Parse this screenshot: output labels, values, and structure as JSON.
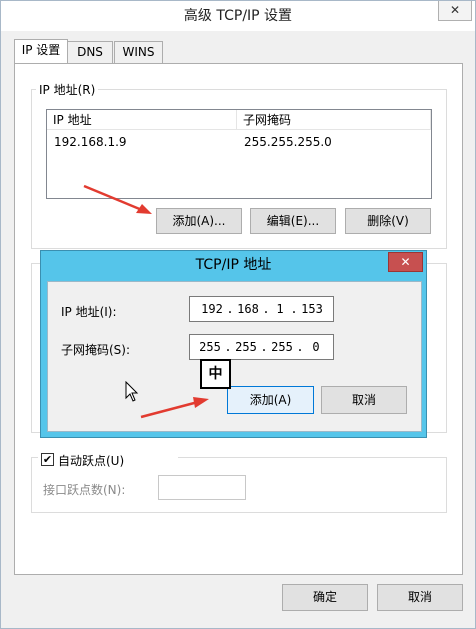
{
  "main_window": {
    "title": "高级 TCP/IP 设置",
    "close_glyph": "✕",
    "tabs": [
      {
        "label": "IP 设置",
        "active": true
      },
      {
        "label": "DNS",
        "active": false
      },
      {
        "label": "WINS",
        "active": false
      }
    ],
    "ip_group": {
      "title": "IP 地址(R)",
      "columns": [
        "IP 地址",
        "子网掩码"
      ],
      "rows": [
        {
          "ip": "192.168.1.9",
          "mask": "255.255.255.0"
        }
      ],
      "buttons": {
        "add": "添加(A)...",
        "edit": "编辑(E)...",
        "delete": "删除(V)"
      }
    },
    "metric": {
      "auto_label": "自动跃点(U)",
      "auto_checked": true,
      "checkbox_glyph": "✔",
      "interface_metric_label": "接口跃点数(N):",
      "interface_metric_value": ""
    },
    "footer": {
      "ok": "确定",
      "cancel": "取消"
    }
  },
  "dialog": {
    "title": "TCP/IP 地址",
    "close_glyph": "✕",
    "ip_label": "IP 地址(I):",
    "ip_octets": [
      "192",
      "168",
      "1",
      "153"
    ],
    "mask_label": "子网掩码(S):",
    "mask_octets": [
      "255",
      "255",
      "255",
      "0"
    ],
    "dot": ".",
    "add_button": "添加(A)",
    "cancel_button": "取消"
  },
  "ime_indicator": "中",
  "colors": {
    "dialog_frame": "#55c5ea",
    "close_red": "#c75050",
    "annotation_red": "#e23b30"
  }
}
